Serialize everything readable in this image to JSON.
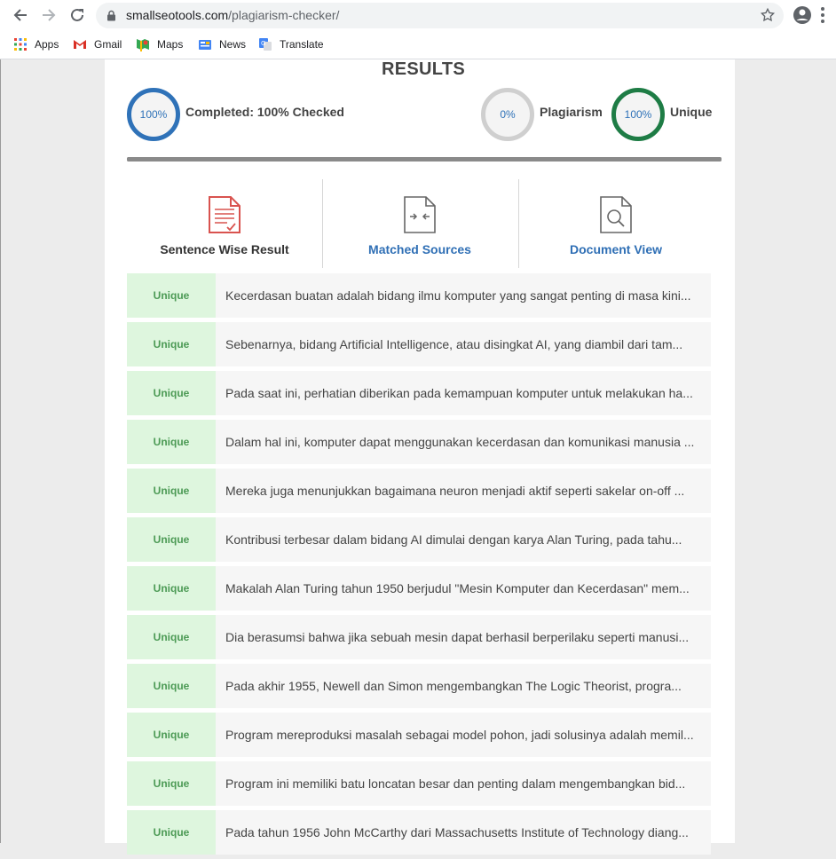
{
  "browser": {
    "url_host": "smallseotools.com",
    "url_path": "/plagiarism-checker/",
    "bookmarks": [
      {
        "label": "Apps",
        "icon": "apps-grid-icon"
      },
      {
        "label": "Gmail",
        "icon": "gmail-icon"
      },
      {
        "label": "Maps",
        "icon": "maps-icon"
      },
      {
        "label": "News",
        "icon": "news-icon"
      },
      {
        "label": "Translate",
        "icon": "translate-icon"
      }
    ]
  },
  "results": {
    "title": "RESULTS",
    "completed": {
      "value": "100%",
      "label": "Completed: 100% Checked",
      "color": "#2f72b8"
    },
    "plagiarism": {
      "value": "0%",
      "label": "Plagiarism",
      "color": "#cfcfcf"
    },
    "unique": {
      "value": "100%",
      "label": "Unique",
      "color": "#1e7c45"
    },
    "progress_fraction": 1.0
  },
  "tabs": [
    {
      "label": "Sentence Wise Result",
      "icon": "sentence-doc-icon",
      "active": true
    },
    {
      "label": "Matched Sources",
      "icon": "compare-doc-icon",
      "active": false
    },
    {
      "label": "Document View",
      "icon": "search-doc-icon",
      "active": false
    }
  ],
  "colors": {
    "link": "#2f6fb5",
    "unique_bg": "#def6de",
    "unique_text": "#4c9a55",
    "accent_red": "#d9534f"
  },
  "sentences": [
    {
      "status": "Unique",
      "text": "Kecerdasan buatan adalah bidang ilmu komputer yang sangat penting di masa kini..."
    },
    {
      "status": "Unique",
      "text": "Sebenarnya, bidang Artificial Intelligence, atau disingkat AI, yang diambil dari tam..."
    },
    {
      "status": "Unique",
      "text": "Pada saat ini, perhatian diberikan pada kemampuan komputer untuk melakukan ha..."
    },
    {
      "status": "Unique",
      "text": "Dalam hal ini, komputer dapat menggunakan kecerdasan dan komunikasi manusia ..."
    },
    {
      "status": "Unique",
      "text": "Mereka juga menunjukkan bagaimana neuron menjadi aktif seperti sakelar on-off ..."
    },
    {
      "status": "Unique",
      "text": "Kontribusi terbesar dalam bidang AI dimulai dengan karya Alan Turing, pada tahu..."
    },
    {
      "status": "Unique",
      "text": "Makalah Alan Turing tahun 1950 berjudul \"Mesin Komputer dan Kecerdasan\" mem..."
    },
    {
      "status": "Unique",
      "text": "Dia berasumsi bahwa jika sebuah mesin dapat berhasil berperilaku seperti manusi..."
    },
    {
      "status": "Unique",
      "text": "Pada akhir 1955, Newell dan Simon mengembangkan The Logic Theorist, progra..."
    },
    {
      "status": "Unique",
      "text": "Program mereproduksi masalah sebagai model pohon, jadi solusinya adalah memil..."
    },
    {
      "status": "Unique",
      "text": "Program ini memiliki batu loncatan besar dan penting dalam mengembangkan bid..."
    },
    {
      "status": "Unique",
      "text": "Pada tahun 1956 John McCarthy dari Massachusetts Institute of Technology diang..."
    }
  ]
}
